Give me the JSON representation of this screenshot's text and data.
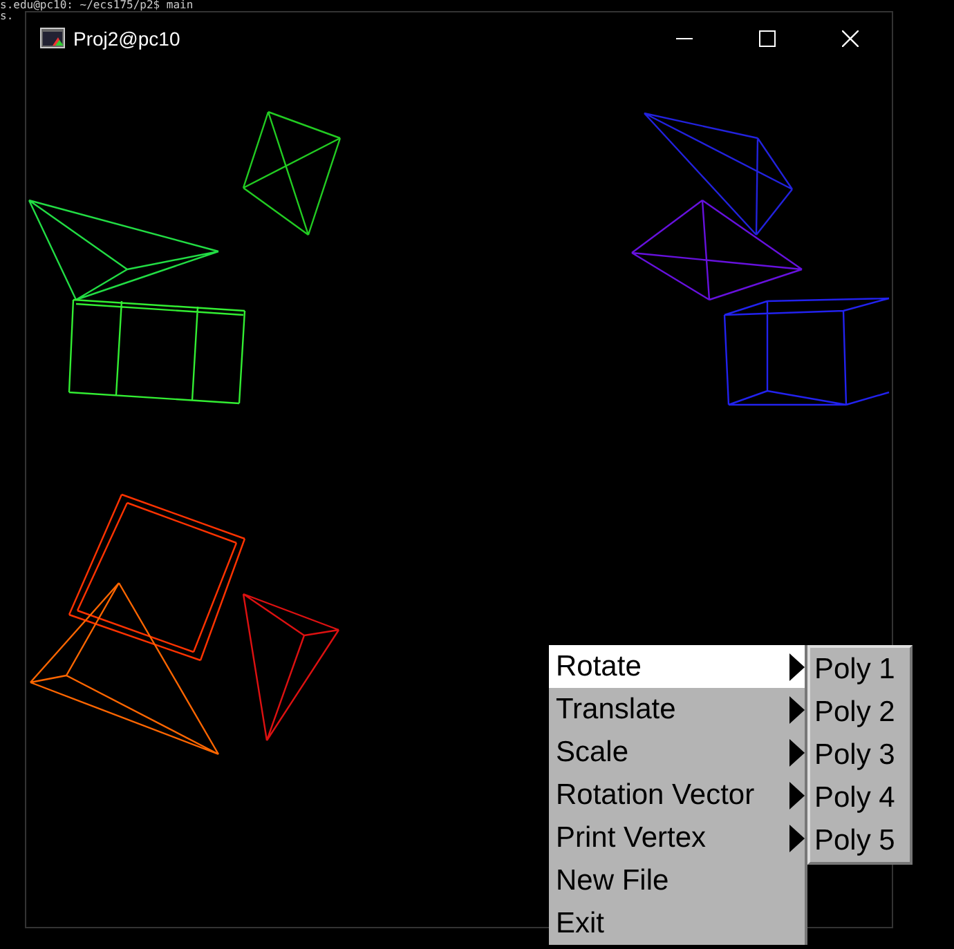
{
  "terminal": {
    "lines": [
      "s.edu@pc10: ~/ecs175/p2$ main",
      "s."
    ]
  },
  "window": {
    "title": "Proj2@pc10"
  },
  "polygons": [
    {
      "color": "#22cc22"
    },
    {
      "color": "#22dd44"
    },
    {
      "color": "#33ee33"
    },
    {
      "color": "#2222dd"
    },
    {
      "color": "#6611dd"
    },
    {
      "color": "#2222ee"
    },
    {
      "color": "#ff3300"
    },
    {
      "color": "#ff6600"
    },
    {
      "color": "#dd1111"
    }
  ],
  "menu": {
    "items": [
      {
        "label": "Rotate",
        "selected": true,
        "submenu": true
      },
      {
        "label": "Translate",
        "selected": false,
        "submenu": true
      },
      {
        "label": "Scale",
        "selected": false,
        "submenu": true
      },
      {
        "label": "Rotation Vector",
        "selected": false,
        "submenu": true
      },
      {
        "label": "Print Vertex",
        "selected": false,
        "submenu": true
      },
      {
        "label": "New File",
        "selected": false,
        "submenu": false
      },
      {
        "label": "Exit",
        "selected": false,
        "submenu": false
      }
    ]
  },
  "submenu": {
    "items": [
      "Poly 1",
      "Poly 2",
      "Poly 3",
      "Poly 4",
      "Poly 5"
    ]
  }
}
